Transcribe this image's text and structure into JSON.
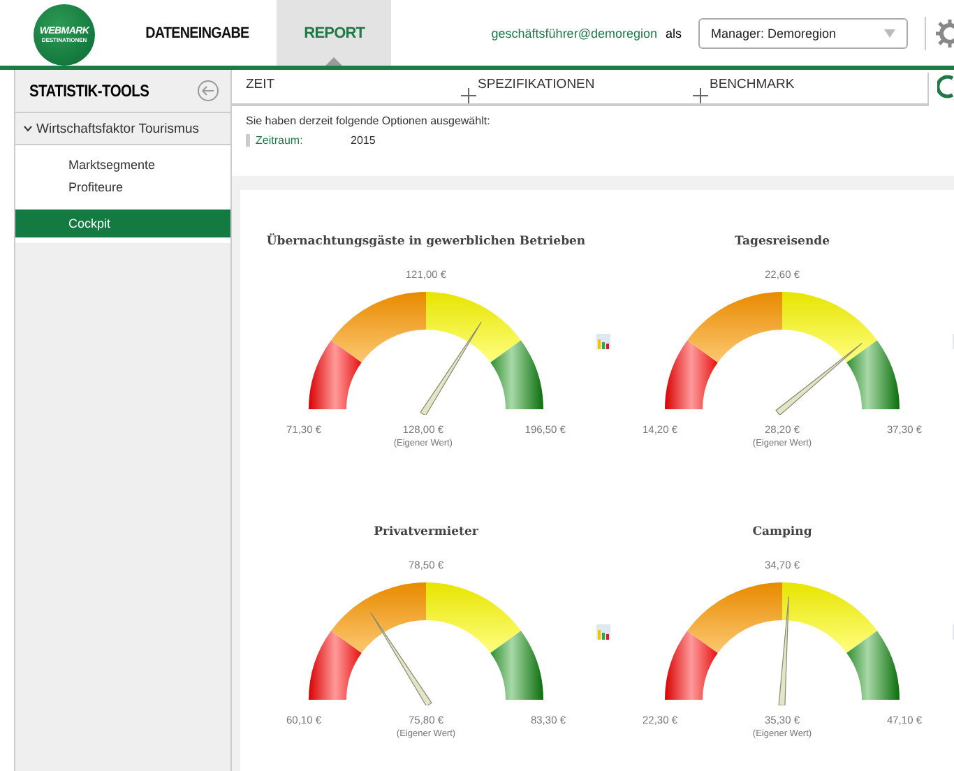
{
  "logo": {
    "name": "WEBMARK",
    "subtitle": "DESTINATIONEN"
  },
  "nav": [
    {
      "label": "DATENEINGABE",
      "selected": false
    },
    {
      "label": "REPORT",
      "selected": true
    }
  ],
  "user": {
    "email": "geschäftsführer@demoregion",
    "as": "als",
    "role": "Manager: Demoregion"
  },
  "sidebar": {
    "title": "STATISTIK-TOOLS",
    "items": [
      {
        "label": "Wirtschaftsfaktor Tourismus",
        "expanded": true,
        "children": [
          {
            "label": "Marktsegmente",
            "selected": false
          },
          {
            "label": "Profiteure",
            "selected": false
          },
          {
            "label": "Cockpit",
            "selected": true
          }
        ]
      }
    ]
  },
  "option_tabs": [
    {
      "label": "ZEIT",
      "kind": "plain"
    },
    {
      "label": "SPEZIFIKATIONEN",
      "kind": "add"
    },
    {
      "label": "BENCHMARK",
      "kind": "add"
    }
  ],
  "selection": {
    "intro": "Sie haben derzeit folgende Optionen ausgewählt:",
    "label": "Zeitraum:",
    "value": "2015"
  },
  "gauges": [
    {
      "title": "Übernachtungsgäste in gewerblichen Betrieben",
      "target": "121,00 €",
      "min": "71,30 €",
      "value": "128,00 €",
      "value_note": "(Eigener Wert)",
      "max": "196,50 €",
      "level": 0.68
    },
    {
      "title": "Tagesreisende",
      "target": "22,60 €",
      "min": "14,20 €",
      "value": "28,20 €",
      "value_note": "(Eigener Wert)",
      "max": "37,30 €",
      "level": 0.78
    },
    {
      "title": "Privatvermieter",
      "target": "78,50 €",
      "min": "60,10 €",
      "value": "75,80 €",
      "value_note": "(Eigener Wert)",
      "max": "83,30 €",
      "level": 0.32
    },
    {
      "title": "Camping",
      "target": "34,70 €",
      "min": "22,30 €",
      "value": "35,30 €",
      "value_note": "(Eigener Wert)",
      "max": "47,10 €",
      "level": 0.52
    }
  ]
}
